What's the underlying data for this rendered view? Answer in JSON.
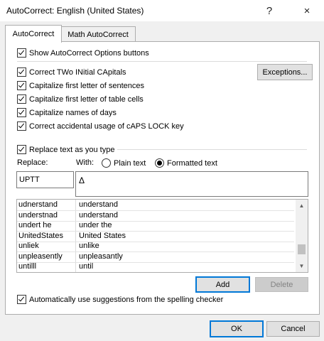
{
  "window": {
    "title": "AutoCorrect: English (United States)",
    "help_icon": "?",
    "close_icon": "×"
  },
  "tabs": [
    {
      "label": "AutoCorrect",
      "active": true
    },
    {
      "label": "Math AutoCorrect",
      "active": false
    }
  ],
  "options": {
    "show_buttons": "Show AutoCorrect Options buttons",
    "correct_two_initial": "Correct TWo INitial CApitals",
    "capitalize_sentences": "Capitalize first letter of sentences",
    "capitalize_table_cells": "Capitalize first letter of table cells",
    "capitalize_days": "Capitalize names of days",
    "correct_caps_lock": "Correct accidental usage of cAPS LOCK key"
  },
  "exceptions_button": "Exceptions...",
  "replace_section": {
    "replace_checkbox": "Replace text as you type",
    "replace_label": "Replace:",
    "with_label": "With:",
    "plain_text": "Plain text",
    "formatted_text": "Formatted text",
    "replace_value": "UPTT",
    "with_value": "Δ"
  },
  "entries": [
    {
      "from": "udnerstand",
      "to": "understand"
    },
    {
      "from": "understnad",
      "to": "understand"
    },
    {
      "from": "undert he",
      "to": "under the"
    },
    {
      "from": "UnitedStates",
      "to": "United States"
    },
    {
      "from": "unliek",
      "to": "unlike"
    },
    {
      "from": "unpleasently",
      "to": "unpleasantly"
    },
    {
      "from": "untilll",
      "to": "until"
    }
  ],
  "scroll_position_fraction": 0.85,
  "add_button": "Add",
  "delete_button": "Delete",
  "suggestions_checkbox": "Automatically use suggestions from the spelling checker",
  "ok_button": "OK",
  "cancel_button": "Cancel",
  "colors": {
    "accent": "#0078d7",
    "window_bg": "#f0f0f0"
  }
}
